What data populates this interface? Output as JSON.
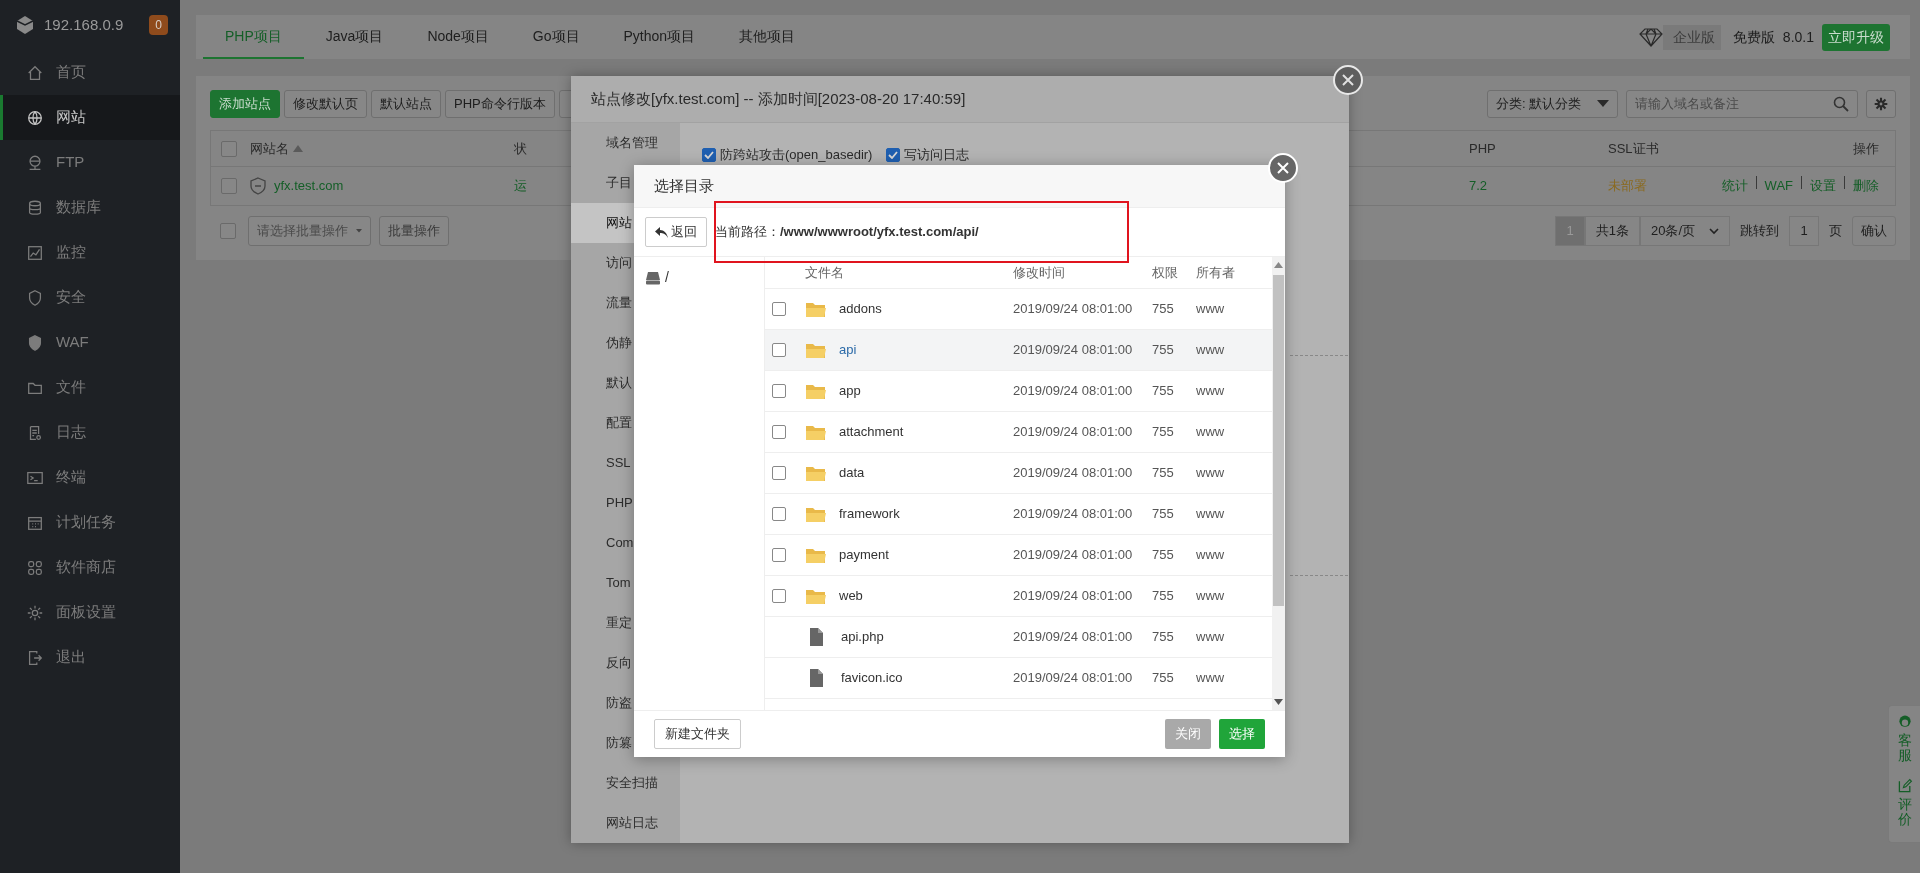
{
  "sidebar": {
    "host": "192.168.0.9",
    "badge": "0",
    "items": [
      {
        "label": "首页",
        "selected": false
      },
      {
        "label": "网站",
        "selected": true
      },
      {
        "label": "FTP",
        "selected": false
      },
      {
        "label": "数据库",
        "selected": false
      },
      {
        "label": "监控",
        "selected": false
      },
      {
        "label": "安全",
        "selected": false
      },
      {
        "label": "WAF",
        "selected": false
      },
      {
        "label": "文件",
        "selected": false
      },
      {
        "label": "日志",
        "selected": false
      },
      {
        "label": "终端",
        "selected": false
      },
      {
        "label": "计划任务",
        "selected": false
      },
      {
        "label": "软件商店",
        "selected": false
      },
      {
        "label": "面板设置",
        "selected": false
      },
      {
        "label": "退出",
        "selected": false
      }
    ]
  },
  "top_tabs": [
    {
      "label": "PHP项目",
      "selected": true
    },
    {
      "label": "Java项目",
      "selected": false
    },
    {
      "label": "Node项目",
      "selected": false
    },
    {
      "label": "Go项目",
      "selected": false
    },
    {
      "label": "Python项目",
      "selected": false
    },
    {
      "label": "其他项目",
      "selected": false
    }
  ],
  "edition": {
    "enterprise": "企业版",
    "free": "免费版",
    "version": "8.0.1",
    "upgrade": "立即升级"
  },
  "site_toolbar": {
    "buttons": [
      "添加站点",
      "修改默认页",
      "默认站点",
      "PHP命令行版本"
    ],
    "category": "分类: 默认分类",
    "search_placeholder": "请输入域名或备注"
  },
  "site_table": {
    "select_all": {
      "checked": false
    },
    "columns": [
      "网站名",
      "状",
      "PHP",
      "SSL证书",
      "操作"
    ],
    "rows": [
      {
        "checked": false,
        "name": "yfx.test.com",
        "status": "运",
        "php": "7.2",
        "ssl": "未部署",
        "actions": [
          "统计",
          "WAF",
          "设置",
          "删除"
        ]
      }
    ]
  },
  "batch": {
    "checked": false,
    "placeholder": "请选择批量操作",
    "button": "批量操作"
  },
  "pagination": {
    "current": "1",
    "total": "共1条",
    "page_size": "20条/页",
    "jump_label": "跳转到",
    "jump_value": "1",
    "page_unit": "页",
    "confirm": "确认"
  },
  "site_dialog": {
    "title": "站点修改[yfx.test.com] -- 添加时间[2023-08-20 17:40:59]",
    "menu": [
      {
        "label": "域名管理",
        "selected": false
      },
      {
        "label": "子目",
        "selected": false
      },
      {
        "label": "网站",
        "selected": true
      },
      {
        "label": "访问",
        "selected": false
      },
      {
        "label": "流量",
        "selected": false
      },
      {
        "label": "伪静",
        "selected": false
      },
      {
        "label": "默认",
        "selected": false
      },
      {
        "label": "配置",
        "selected": false
      },
      {
        "label": "SSL",
        "selected": false
      },
      {
        "label": "PHP",
        "selected": false
      },
      {
        "label": "Com",
        "selected": false
      },
      {
        "label": "Tom",
        "selected": false
      },
      {
        "label": "重定",
        "selected": false
      },
      {
        "label": "反向",
        "selected": false
      },
      {
        "label": "防盗",
        "selected": false
      },
      {
        "label": "防篡",
        "selected": false
      },
      {
        "label": "安全扫描",
        "selected": false
      },
      {
        "label": "网站日志",
        "selected": false
      }
    ],
    "options": [
      {
        "label": "防跨站攻击(open_basedir)",
        "checked": true
      },
      {
        "label": "写访问日志",
        "checked": true
      }
    ]
  },
  "dir_dialog": {
    "title": "选择目录",
    "back": "返回",
    "path": "当前路径：**/www/wwwroot/yfx.test.com/api/**",
    "tree_root": "/",
    "columns": [
      "文件名",
      "修改时间",
      "权限",
      "所有者"
    ],
    "rows": [
      {
        "kind": "folder",
        "checked": false,
        "selected": false,
        "name": "addons",
        "modified": "2019/09/24 08:01:00",
        "perm": "755",
        "owner": "www"
      },
      {
        "kind": "folder",
        "checked": false,
        "selected": true,
        "name": "api",
        "modified": "2019/09/24 08:01:00",
        "perm": "755",
        "owner": "www"
      },
      {
        "kind": "folder",
        "checked": false,
        "selected": false,
        "name": "app",
        "modified": "2019/09/24 08:01:00",
        "perm": "755",
        "owner": "www"
      },
      {
        "kind": "folder",
        "checked": false,
        "selected": false,
        "name": "attachment",
        "modified": "2019/09/24 08:01:00",
        "perm": "755",
        "owner": "www"
      },
      {
        "kind": "folder",
        "checked": false,
        "selected": false,
        "name": "data",
        "modified": "2019/09/24 08:01:00",
        "perm": "755",
        "owner": "www"
      },
      {
        "kind": "folder",
        "checked": false,
        "selected": false,
        "name": "framework",
        "modified": "2019/09/24 08:01:00",
        "perm": "755",
        "owner": "www"
      },
      {
        "kind": "folder",
        "checked": false,
        "selected": false,
        "name": "payment",
        "modified": "2019/09/24 08:01:00",
        "perm": "755",
        "owner": "www"
      },
      {
        "kind": "folder",
        "checked": false,
        "selected": false,
        "name": "web",
        "modified": "2019/09/24 08:01:00",
        "perm": "755",
        "owner": "www"
      },
      {
        "kind": "file",
        "selected": false,
        "name": "api.php",
        "modified": "2019/09/24 08:01:00",
        "perm": "755",
        "owner": "www"
      },
      {
        "kind": "file",
        "selected": false,
        "name": "favicon.ico",
        "modified": "2019/09/24 08:01:00",
        "perm": "755",
        "owner": "www"
      }
    ],
    "buttons": {
      "new_folder": "新建文件夹",
      "close": "关闭",
      "select": "选择"
    }
  },
  "float_bar": [
    "客服",
    "评价"
  ]
}
